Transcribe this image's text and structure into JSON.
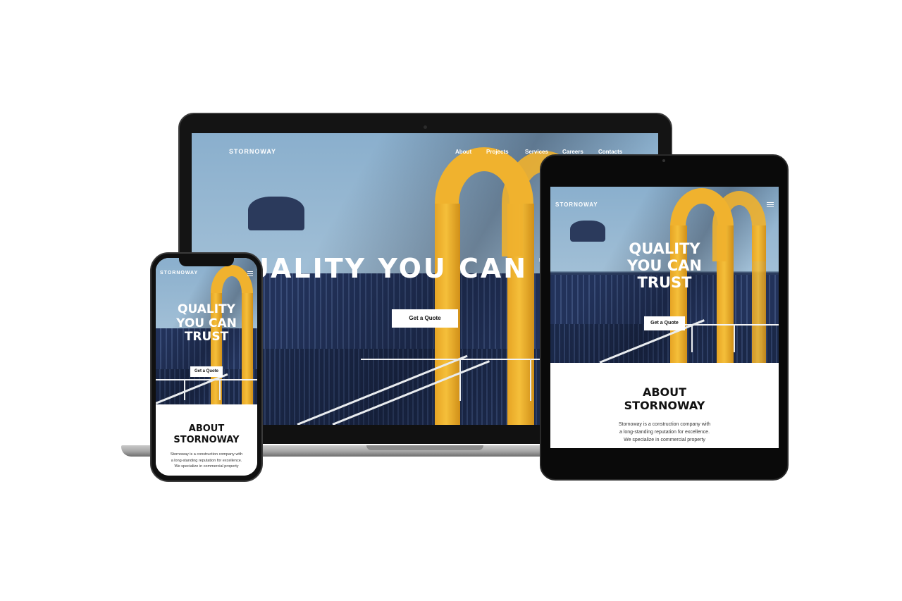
{
  "site": {
    "brand": "STORNOWAY",
    "nav": [
      "About",
      "Projects",
      "Services",
      "Careers",
      "Contacts"
    ],
    "hero_headline_laptop": "QUALITY YOU CAN TRUST",
    "hero_headline_lines": [
      "QUALITY",
      "YOU CAN",
      "TRUST"
    ],
    "cta_label": "Get a Quote",
    "about_title_lines": [
      "ABOUT",
      "STORNOWAY"
    ],
    "about_body_lines": [
      "Stornoway is a construction company with",
      "a long-standing reputation for excellence.",
      "We specialize in commercial property"
    ]
  },
  "devices": [
    "laptop",
    "tablet",
    "phone"
  ],
  "icons": {
    "menu": "hamburger-menu-icon"
  },
  "colors": {
    "accent_yellow": "#f0b22e",
    "sky": "#8fb1cd",
    "building": "#22325a",
    "device_frame": "#141414"
  }
}
